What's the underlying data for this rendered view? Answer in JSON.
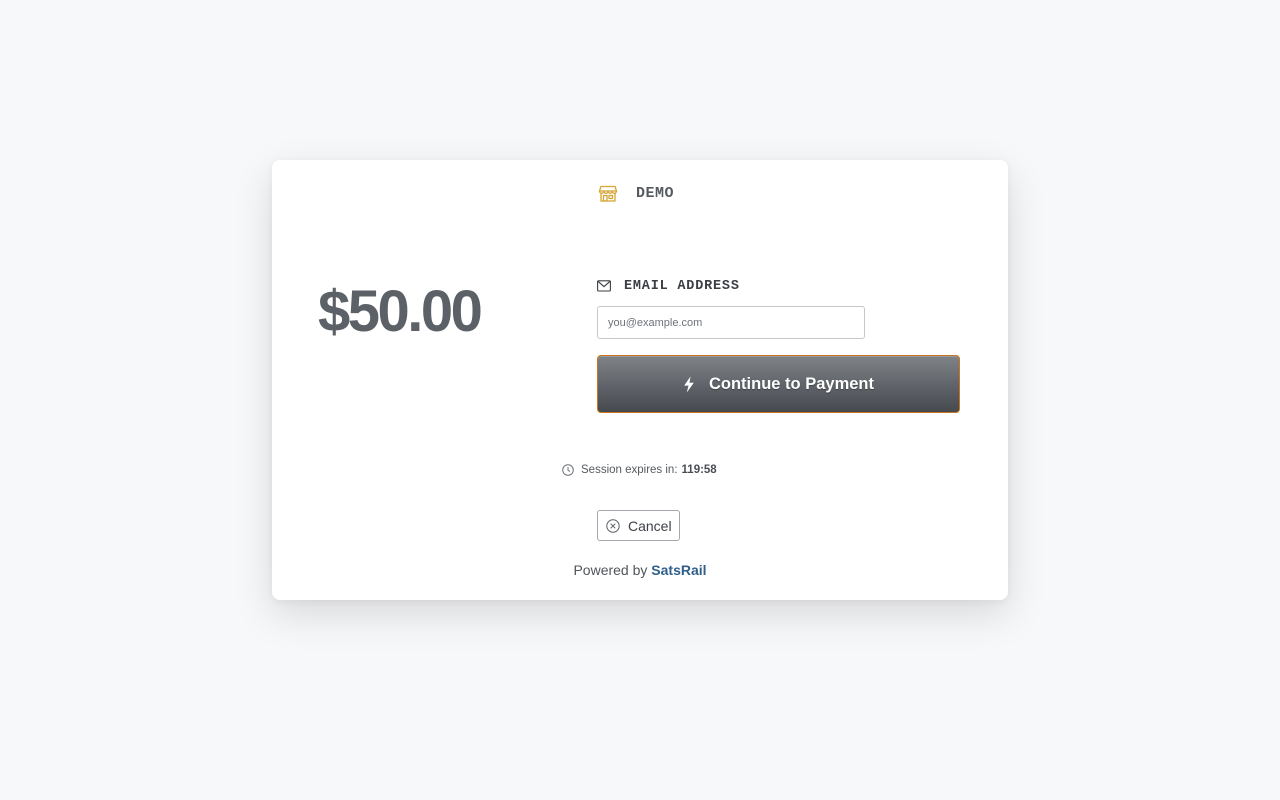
{
  "merchant": {
    "name": "DEMO",
    "icon": "storefront-icon",
    "icon_color": "#d7a431"
  },
  "amount": "$50.00",
  "email": {
    "label": "EMAIL ADDRESS",
    "icon": "envelope-icon",
    "value": "",
    "placeholder": "you@example.com"
  },
  "pay_button": {
    "label": "Continue to Payment",
    "icon": "lightning-icon",
    "border_color": "#c8741f"
  },
  "session": {
    "label": "Session expires in:",
    "time": "119:58",
    "icon": "clock-icon"
  },
  "cancel_button": {
    "label": "Cancel",
    "icon": "close-circle-icon"
  },
  "footer": {
    "powered_by": "Powered by",
    "brand": "SatsRail",
    "brand_color": "#2f5f8a"
  }
}
